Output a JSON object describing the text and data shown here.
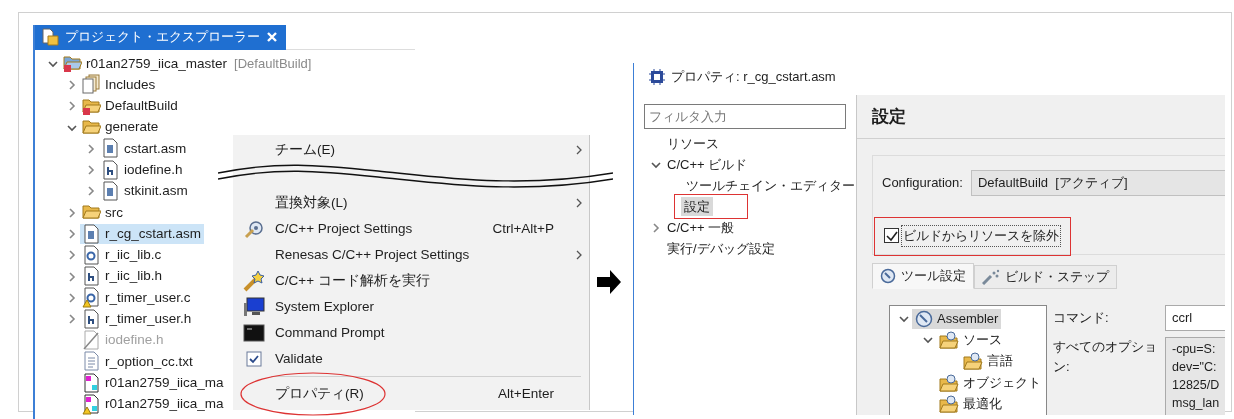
{
  "explorer": {
    "title": "プロジェクト・エクスプローラー",
    "tree": [
      {
        "label": "r01an2759_iica_master",
        "suffix": "[DefaultBuild]",
        "kind": "project",
        "expanded": true,
        "selected": false,
        "disabled": false,
        "warning": false,
        "children": [
          {
            "label": "Includes",
            "kind": "includes",
            "expanded": false,
            "selected": false,
            "disabled": false,
            "warning": false
          },
          {
            "label": "DefaultBuild",
            "kind": "build-folder",
            "expanded": false,
            "selected": false,
            "disabled": false,
            "warning": false
          },
          {
            "label": "generate",
            "kind": "folder",
            "expanded": true,
            "selected": false,
            "disabled": false,
            "warning": false,
            "children": [
              {
                "label": "cstart.asm",
                "kind": "asm",
                "expanded": false,
                "selected": false,
                "disabled": false,
                "warning": false
              },
              {
                "label": "iodefine.h",
                "kind": "header",
                "expanded": false,
                "selected": false,
                "disabled": false,
                "warning": false
              },
              {
                "label": "stkinit.asm",
                "kind": "asm",
                "expanded": false,
                "selected": false,
                "disabled": false,
                "warning": false
              }
            ]
          },
          {
            "label": "src",
            "kind": "folder",
            "expanded": false,
            "selected": false,
            "disabled": false,
            "warning": false
          },
          {
            "label": "r_cg_cstart.asm",
            "kind": "asm",
            "expanded": false,
            "selected": true,
            "disabled": false,
            "warning": false
          },
          {
            "label": "r_iic_lib.c",
            "kind": "source",
            "expanded": false,
            "selected": false,
            "disabled": false,
            "warning": false
          },
          {
            "label": "r_iic_lib.h",
            "kind": "header",
            "expanded": false,
            "selected": false,
            "disabled": false,
            "warning": false
          },
          {
            "label": "r_timer_user.c",
            "kind": "source",
            "expanded": false,
            "selected": false,
            "disabled": false,
            "warning": true
          },
          {
            "label": "r_timer_user.h",
            "kind": "header",
            "expanded": false,
            "selected": false,
            "disabled": false,
            "warning": false
          },
          {
            "label": "iodefine.h",
            "kind": "excluded",
            "selected": false,
            "disabled": true,
            "warning": false
          },
          {
            "label": "r_option_cc.txt",
            "kind": "text",
            "selected": false,
            "disabled": false,
            "warning": false
          },
          {
            "label": "r01an2759_iica_ma",
            "kind": "map",
            "selected": false,
            "disabled": false,
            "warning": false
          },
          {
            "label": "r01an2759_iica_ma",
            "kind": "map",
            "selected": false,
            "disabled": false,
            "warning": true
          }
        ]
      }
    ]
  },
  "context_menu": {
    "items": [
      {
        "kind": "item",
        "label": "チーム(E)",
        "submenu": true,
        "highlighted": false
      },
      {
        "kind": "break"
      },
      {
        "kind": "item",
        "label": "置換対象(L)",
        "submenu": true,
        "highlighted": false
      },
      {
        "kind": "item",
        "label": "C/C++ Project Settings",
        "shortcut": "Ctrl+Alt+P",
        "submenu": false,
        "highlighted": false
      },
      {
        "kind": "item",
        "label": "Renesas C/C++ Project Settings",
        "submenu": true,
        "highlighted": false
      },
      {
        "kind": "item",
        "label": "C/C++ コード解析を実行",
        "submenu": false,
        "highlighted": false
      },
      {
        "kind": "item",
        "label": "System Explorer",
        "submenu": false,
        "highlighted": false
      },
      {
        "kind": "item",
        "label": "Command Prompt",
        "submenu": false,
        "highlighted": false
      },
      {
        "kind": "item",
        "label": "Validate",
        "submenu": false,
        "highlighted": false
      },
      {
        "kind": "separator"
      },
      {
        "kind": "item",
        "label": "プロパティ(R)",
        "shortcut": "Alt+Enter",
        "submenu": false,
        "highlighted": true
      }
    ]
  },
  "dialog": {
    "title": "プロパティ: r_cg_cstart.asm",
    "filter": {
      "placeholder": "フィルタ入力"
    },
    "nav": [
      {
        "label": "リソース",
        "selected": false,
        "highlighted": false
      },
      {
        "label": "C/C++ ビルド",
        "expanded": true,
        "selected": false,
        "highlighted": false,
        "children": [
          {
            "label": "ツールチェイン・エディター",
            "selected": false,
            "highlighted": false
          },
          {
            "label": "設定",
            "selected": true,
            "highlighted": true
          }
        ]
      },
      {
        "label": "C/C++ 一般",
        "expanded": false,
        "selected": false,
        "highlighted": false
      },
      {
        "label": "実行/デバッグ設定",
        "selected": false,
        "highlighted": false
      }
    ],
    "page_title": "設定",
    "configuration": {
      "label": "Configuration:",
      "value": "DefaultBuild  [アクティブ]"
    },
    "exclude": {
      "label": "ビルドからリソースを除外",
      "checked": true,
      "highlighted": true
    },
    "tabs": [
      {
        "label": "ツール設定",
        "kind": "tool",
        "selected": true
      },
      {
        "label": "ビルド・ステップ",
        "kind": "steps",
        "selected": false
      }
    ],
    "tool_tree": [
      {
        "label": "Assembler",
        "kind": "tool",
        "expanded": true,
        "selected": true,
        "children": [
          {
            "label": "ソース",
            "kind": "category",
            "expanded": true,
            "selected": false,
            "children": [
              {
                "label": "言語",
                "kind": "category",
                "selected": false
              }
            ]
          },
          {
            "label": "オブジェクト",
            "kind": "category",
            "selected": false
          },
          {
            "label": "最適化",
            "kind": "category",
            "selected": false
          }
        ]
      }
    ],
    "command": {
      "label": "コマンド:",
      "value": "ccrl"
    },
    "options": {
      "label": "すべてのオプション:",
      "lines": [
        "-cpu=S:",
        "dev=\"C:",
        "12825/D",
        "msg_lan"
      ]
    }
  }
}
